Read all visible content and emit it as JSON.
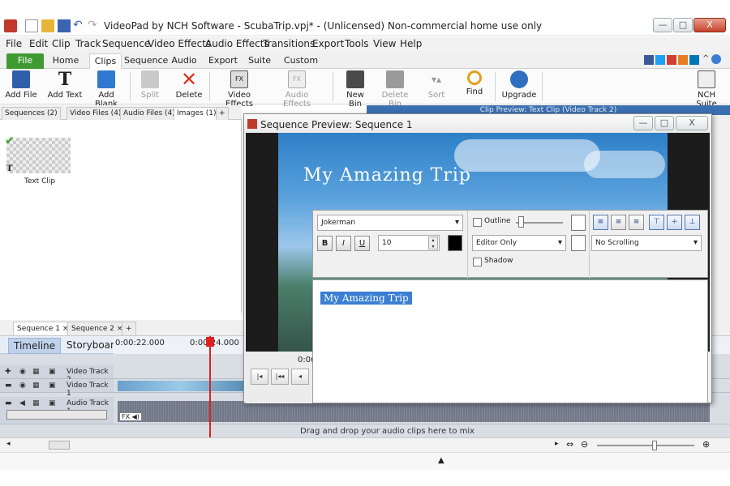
{
  "window": {
    "title": "VideoPad by NCH Software - ScubaTrip.vpj* - (Unlicensed) Non-commercial home use only",
    "minimize": "—",
    "maximize": "□",
    "close": "X"
  },
  "menu": [
    "File",
    "Edit",
    "Clip",
    "Track",
    "Sequence",
    "Video Effects",
    "Audio Effects",
    "Transitions",
    "Export",
    "Tools",
    "View",
    "Help"
  ],
  "ribbon_tabs": {
    "file": "File",
    "home": "Home",
    "clips": "Clips",
    "sequence": "Sequence",
    "audio": "Audio",
    "export": "Export",
    "suite": "Suite",
    "custom": "Custom"
  },
  "toolbar": {
    "add_file": "Add File",
    "add_text": "Add Text",
    "add_blank": "Add Blank",
    "split": "Split",
    "delete": "Delete",
    "video_effects": "Video Effects",
    "audio_effects": "Audio Effects",
    "new_bin": "New Bin",
    "delete_bin": "Delete Bin",
    "sort": "Sort",
    "find": "Find",
    "upgrade": "Upgrade",
    "nch_suite": "NCH Suite"
  },
  "bin_tabs": {
    "sequences": "Sequences (2)",
    "video_files": "Video Files (4)",
    "audio_files": "Audio Files (4)",
    "images": "Images (1)",
    "add": "+"
  },
  "bin_items": [
    {
      "label": "Text Clip"
    }
  ],
  "clip_preview_title": "Clip Preview: Text Clip (Video Track 2)",
  "sequence_preview": {
    "title": "Sequence Preview: Sequence 1",
    "video_title_text": "My Amazing Trip",
    "time_partial": "0:0("
  },
  "text_editor": {
    "font": "Jokerman",
    "bold": "B",
    "italic": "I",
    "underline": "U",
    "size": "10",
    "outline_label": "Outline",
    "editor_mode": "Editor Only",
    "shadow_label": "Shadow",
    "scrolling": "No Scrolling",
    "text": "My Amazing Trip"
  },
  "sequence_tabs": {
    "seq1": "Sequence 1 ×",
    "seq2": "Sequence 2 ×",
    "add": "+"
  },
  "timeline": {
    "timeline_tab": "Timeline",
    "storyboard_tab": "Storyboard",
    "t1": "0:00:22.000",
    "t2": "0:00:24.000",
    "tracks": [
      "Video Track 2",
      "Video Track 1",
      "Audio Track 1"
    ],
    "audio_hint": "Drag and drop your audio clips here to mix"
  },
  "colors": {
    "accent": "#3a7fd2",
    "file_tab": "#3f9a31",
    "playhead": "#e02020"
  }
}
